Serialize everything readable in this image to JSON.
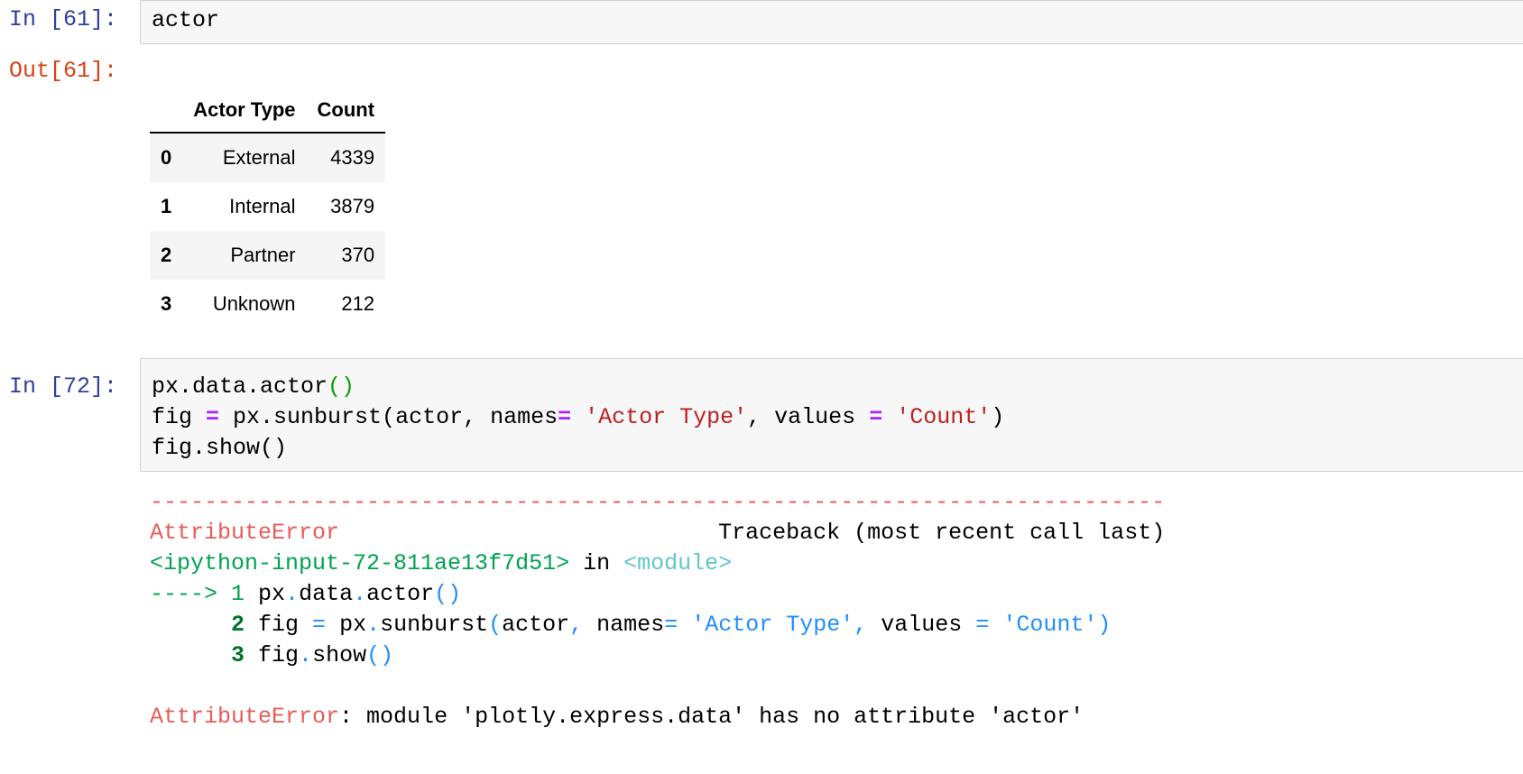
{
  "cell1": {
    "in_prompt": "In [61]:",
    "code": "actor",
    "out_prompt": "Out[61]:"
  },
  "dataframe": {
    "columns": [
      "",
      "Actor Type",
      "Count"
    ],
    "rows": [
      {
        "index": "0",
        "actor_type": "External",
        "count": "4339"
      },
      {
        "index": "1",
        "actor_type": "Internal",
        "count": "3879"
      },
      {
        "index": "2",
        "actor_type": "Partner",
        "count": "370"
      },
      {
        "index": "3",
        "actor_type": "Unknown",
        "count": "212"
      }
    ]
  },
  "cell2": {
    "in_prompt": "In [72]:",
    "line1": {
      "a": "px.data.actor",
      "b": "()"
    },
    "line2": {
      "a": "fig ",
      "eq1": "=",
      "b": " px.sunburst(actor, names",
      "eq2": "=",
      "c": " ",
      "s1": "'Actor Type'",
      "d": ", values ",
      "eq3": "=",
      "e": " ",
      "s2": "'Count'",
      "f": ")"
    },
    "line3": "fig.show()"
  },
  "traceback": {
    "dashes": "---------------------------------------------------------------------------",
    "error_name": "AttributeError",
    "header_right": "                            Traceback (most recent call last)",
    "input_ref": "<ipython-input-72-811ae13f7d51>",
    "in_word": " in ",
    "module_ref": "<module>",
    "arrow": "----> 1",
    "arrow_line": {
      "a": " px",
      "dot1": ".",
      "b": "data",
      "dot2": ".",
      "c": "actor",
      "p": "()"
    },
    "line2_num": "      2",
    "line2": {
      "a": " fig ",
      "eq": "=",
      "b": " px",
      "dot": ".",
      "c": "sunburst",
      "p1": "(",
      "d": "actor",
      "comma1": ",",
      "e": " names",
      "eq2": "=",
      "f": " ",
      "s1": "'Actor Type'",
      "comma2": ",",
      "g": " values ",
      "eq3": "=",
      "h": " ",
      "s2": "'Count'",
      "p2": ")"
    },
    "line3_num": "      3",
    "line3": {
      "a": " fig",
      "dot": ".",
      "b": "show",
      "p": "()"
    },
    "final_error": "AttributeError",
    "final_message": ": module 'plotly.express.data' has no attribute 'actor'"
  }
}
